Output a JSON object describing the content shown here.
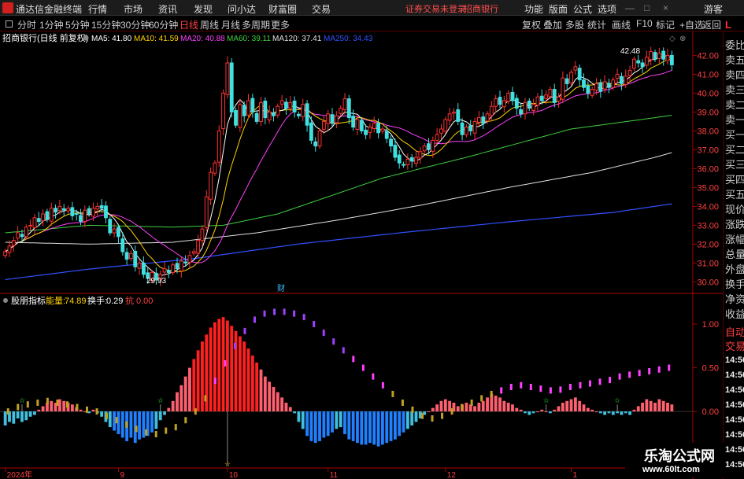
{
  "titlebar": {
    "app_title": "通达信金融终端",
    "menu": [
      "行情",
      "市场",
      "资讯",
      "发现",
      "问小达",
      "财富圈",
      "交易"
    ],
    "notice": "证券交易未登录",
    "stock_name": "招商银行",
    "right_menu": [
      "功能",
      "版面",
      "公式",
      "选项"
    ],
    "guest": "游客"
  },
  "periodbar": {
    "periods": [
      "分时",
      "1分钟",
      "5分钟",
      "15分钟",
      "30分钟",
      "60分钟",
      "日线",
      "周线",
      "月线",
      "多周期",
      "更多"
    ],
    "active": "日线",
    "tools": [
      "复权",
      "叠加",
      "多股",
      "统计",
      "画线",
      "F10",
      "标记",
      "+自选",
      "返回"
    ]
  },
  "main_panel": {
    "title": "招商银行(日线 前复权)",
    "ma_labels": [
      {
        "text": "MA5: 41.80",
        "color": "#ffffff"
      },
      {
        "text": "MA10: 41.59",
        "color": "#ffd200"
      },
      {
        "text": "MA20: 40.88",
        "color": "#ff40ff"
      },
      {
        "text": "MA60: 39.11",
        "color": "#40d040"
      },
      {
        "text": "MA120: 37.41",
        "color": "#e0e0e0"
      },
      {
        "text": "MA250: 34.43",
        "color": "#3050ff"
      }
    ],
    "high_label": "42.48",
    "low_label": "29.93",
    "cai_marker": "财"
  },
  "sub_panel": {
    "title": "股朋指标",
    "energy_label": "能量:",
    "energy_value": "74.89",
    "turnover_label": "换手:",
    "turnover_value": "0.29",
    "third_label": "抗",
    "third_value": "0.00"
  },
  "sidepanel": {
    "logo": "L",
    "items": [
      "委比",
      "卖五",
      "卖四",
      "卖三",
      "卖二",
      "卖一",
      "买一",
      "买二",
      "买三",
      "买四",
      "买五",
      "现价",
      "涨跌",
      "涨幅",
      "总量",
      "外盘",
      "换手",
      "净资",
      "收益",
      "自动",
      "交易"
    ],
    "times": [
      "14:56",
      "14:56",
      "14:56",
      "14:56",
      "14:56",
      "14:56",
      "14:56",
      "14:56"
    ]
  },
  "watermark": {
    "line1": "乐淘公式网",
    "line2": "www.60lt.com"
  },
  "colors": {
    "up": "#ff3030",
    "down": "#40e0e0",
    "axis": "#aa0000",
    "grid": "#550000"
  },
  "chart_data": {
    "type": "candlestick",
    "price_axis": {
      "ticks": [
        30.0,
        31.0,
        32.0,
        33.0,
        34.0,
        35.0,
        36.0,
        37.0,
        38.0,
        39.0,
        40.0,
        41.0,
        42.0
      ],
      "range": [
        29.6,
        42.6
      ]
    },
    "indicator_axis": {
      "ticks": [
        1.0,
        0.5,
        0.0,
        -0.5
      ],
      "range": [
        -0.62,
        1.18
      ]
    },
    "x_labels": [
      {
        "label": "2024年",
        "index": 0
      },
      {
        "label": "9",
        "index": 27
      },
      {
        "label": "10",
        "index": 53
      },
      {
        "label": "11",
        "index": 77
      },
      {
        "label": "12",
        "index": 105
      },
      {
        "label": "1",
        "index": 135
      },
      {
        "label": "2",
        "index": 160
      }
    ],
    "closes": [
      31.6,
      31.9,
      32.2,
      32.6,
      32.4,
      32.9,
      33.0,
      33.4,
      33.2,
      33.6,
      33.3,
      33.9,
      33.7,
      34.0,
      33.8,
      33.9,
      33.5,
      33.6,
      33.2,
      33.8,
      33.6,
      33.9,
      34.0,
      33.9,
      33.4,
      32.6,
      32.8,
      32.4,
      31.6,
      31.2,
      31.5,
      30.8,
      31.0,
      30.4,
      30.2,
      30.5,
      30.1,
      30.4,
      30.7,
      30.5,
      30.9,
      30.7,
      31.1,
      31.0,
      31.4,
      31.6,
      32.2,
      32.8,
      34.5,
      35.8,
      36.3,
      38.0,
      40.0,
      41.6,
      39.0,
      38.3,
      39.4,
      38.8,
      39.6,
      39.0,
      38.5,
      39.5,
      38.7,
      39.0,
      38.8,
      39.3,
      39.6,
      39.2,
      39.5,
      39.0,
      38.8,
      39.4,
      38.3,
      37.5,
      37.2,
      38.0,
      38.5,
      38.9,
      38.4,
      38.8,
      39.2,
      39.7,
      38.7,
      38.2,
      38.6,
      38.0,
      37.8,
      38.2,
      38.4,
      37.9,
      38.1,
      37.6,
      37.2,
      36.6,
      36.3,
      36.2,
      36.5,
      36.4,
      36.6,
      36.9,
      37.2,
      37.0,
      37.5,
      37.8,
      38.1,
      38.6,
      38.9,
      39.0,
      38.5,
      37.8,
      38.2,
      38.0,
      38.5,
      38.7,
      38.4,
      38.9,
      39.3,
      39.7,
      39.4,
      39.6,
      40.0,
      39.6,
      39.2,
      38.9,
      39.5,
      39.2,
      39.4,
      39.8,
      39.6,
      39.9,
      40.2,
      39.5,
      39.8,
      40.8,
      40.5,
      41.1,
      41.4,
      40.7,
      40.3,
      40.0,
      40.2,
      40.5,
      40.1,
      40.6,
      40.3,
      40.7,
      41.0,
      40.5,
      40.9,
      41.2,
      41.8,
      41.6,
      41.4,
      41.9,
      42.2,
      41.8,
      42.1,
      41.8,
      42.0,
      41.5
    ],
    "series": [
      {
        "name": "MA5",
        "color": "#ffffff"
      },
      {
        "name": "MA10",
        "color": "#ffd200"
      },
      {
        "name": "MA20",
        "color": "#ff40ff"
      },
      {
        "name": "MA60",
        "color": "#40d040"
      },
      {
        "name": "MA120",
        "color": "#e0e0e0"
      },
      {
        "name": "MA250",
        "color": "#3050ff"
      }
    ],
    "ma250_values": [
      30.12,
      30.68,
      31.23,
      32.01,
      32.62,
      33.18,
      33.68,
      34.43
    ],
    "ma250_indices": [
      0,
      20,
      45,
      70,
      95,
      120,
      145,
      168
    ],
    "ma120_values": [
      32.1,
      32.0,
      32.1,
      32.6,
      33.3,
      34.1,
      35.0,
      35.8,
      36.6,
      37.41
    ],
    "ma120_indices": [
      0,
      20,
      40,
      60,
      80,
      100,
      120,
      140,
      155,
      168
    ],
    "ma60_values": [
      32.6,
      33.0,
      32.9,
      33.0,
      33.6,
      35.5,
      36.6,
      38.1,
      38.7,
      39.11
    ],
    "ma60_indices": [
      0,
      20,
      40,
      52,
      65,
      90,
      110,
      135,
      155,
      168
    ],
    "indicator_values": [
      -0.16,
      -0.12,
      -0.14,
      -0.08,
      -0.12,
      -0.1,
      -0.06,
      -0.04,
      0.02,
      0.06,
      0.1,
      0.12,
      0.1,
      0.14,
      0.12,
      0.1,
      0.08,
      0.05,
      0.02,
      0.0,
      -0.02,
      0.02,
      -0.02,
      -0.06,
      -0.12,
      -0.18,
      -0.22,
      -0.26,
      -0.3,
      -0.34,
      -0.3,
      -0.36,
      -0.32,
      -0.3,
      -0.28,
      -0.24,
      -0.2,
      -0.1,
      -0.04,
      0.04,
      0.12,
      0.22,
      0.3,
      0.4,
      0.5,
      0.6,
      0.7,
      0.8,
      0.88,
      0.96,
      1.02,
      1.06,
      1.08,
      1.04,
      0.98,
      0.92,
      0.86,
      0.8,
      0.72,
      0.64,
      0.56,
      0.48,
      0.4,
      0.34,
      0.28,
      0.22,
      0.16,
      0.1,
      0.05,
      -0.02,
      -0.12,
      -0.2,
      -0.28,
      -0.34,
      -0.36,
      -0.34,
      -0.3,
      -0.28,
      -0.24,
      -0.2,
      -0.18,
      -0.26,
      -0.32,
      -0.34,
      -0.36,
      -0.38,
      -0.38,
      -0.36,
      -0.38,
      -0.4,
      -0.38,
      -0.36,
      -0.34,
      -0.32,
      -0.28,
      -0.24,
      -0.2,
      -0.16,
      -0.12,
      -0.08,
      -0.04,
      0.0,
      0.04,
      0.08,
      0.12,
      0.14,
      0.12,
      0.1,
      0.06,
      0.08,
      0.1,
      0.08,
      0.06,
      0.1,
      0.12,
      0.16,
      0.2,
      0.18,
      0.16,
      0.12,
      0.1,
      0.08,
      0.04,
      0.02,
      -0.02,
      -0.04,
      -0.02,
      0.0,
      0.02,
      0.0,
      -0.02,
      0.02,
      0.06,
      0.1,
      0.12,
      0.14,
      0.16,
      0.12,
      0.08,
      0.04,
      0.02,
      0.0,
      -0.02,
      -0.04,
      -0.02,
      -0.04,
      -0.02,
      -0.04,
      -0.02,
      -0.04,
      0.02,
      0.06,
      0.1,
      0.14,
      0.12,
      0.1,
      0.14,
      0.12,
      0.1,
      0.08,
      0.06,
      0.04
    ],
    "energy_line_values": [
      0.0,
      0.05,
      0.08,
      0.1,
      0.12,
      0.1,
      0.08,
      0.05,
      0.02,
      0.0,
      -0.05,
      -0.1,
      -0.15,
      -0.2,
      -0.24,
      -0.26,
      -0.22,
      -0.18,
      -0.1,
      0.0,
      0.15,
      0.35,
      0.55,
      0.75,
      0.92,
      1.05,
      1.12,
      1.14,
      1.14,
      1.12,
      1.08,
      1.0,
      0.9,
      0.8,
      0.7,
      0.6,
      0.5,
      0.4,
      0.3,
      0.2,
      0.1,
      0.02,
      -0.05,
      -0.08,
      -0.05,
      0.0,
      0.05,
      0.1,
      0.15,
      0.2,
      0.24,
      0.28,
      0.3,
      0.28,
      0.26,
      0.24,
      0.25,
      0.28,
      0.3,
      0.32,
      0.34,
      0.36,
      0.4,
      0.42,
      0.44,
      0.46,
      0.48,
      0.5
    ],
    "star_markers": [
      4,
      37,
      129,
      146
    ]
  }
}
